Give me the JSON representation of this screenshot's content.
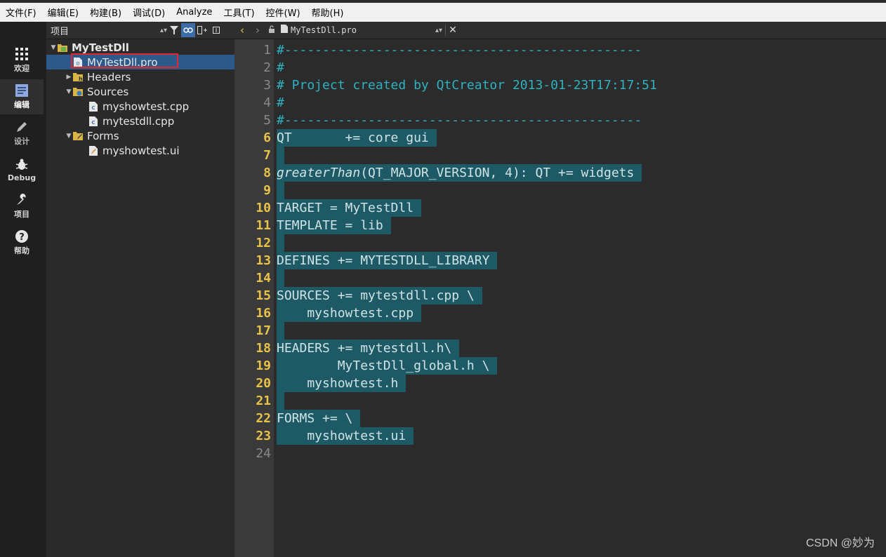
{
  "menubar": {
    "items": [
      "文件(F)",
      "编辑(E)",
      "构建(B)",
      "调试(D)",
      "Analyze",
      "工具(T)",
      "控件(W)",
      "帮助(H)"
    ]
  },
  "modes": [
    {
      "label": "欢迎",
      "icon": "grid-icon"
    },
    {
      "label": "编辑",
      "icon": "document-icon"
    },
    {
      "label": "设计",
      "icon": "pencil-icon"
    },
    {
      "label": "Debug",
      "icon": "bug-icon"
    },
    {
      "label": "项目",
      "icon": "wrench-icon"
    },
    {
      "label": "帮助",
      "icon": "help-icon"
    }
  ],
  "project_panel": {
    "selector_label": "项目",
    "tree": [
      {
        "label": "MyTestDll",
        "level": 0,
        "expanded": true,
        "icon": "project-icon"
      },
      {
        "label": "MyTestDll.pro",
        "level": 1,
        "selected": true,
        "icon": "pro-file-icon"
      },
      {
        "label": "Headers",
        "level": 1,
        "expanded": false,
        "icon": "headers-folder-icon"
      },
      {
        "label": "Sources",
        "level": 1,
        "expanded": true,
        "icon": "sources-folder-icon"
      },
      {
        "label": "myshowtest.cpp",
        "level": 2,
        "icon": "cpp-file-icon"
      },
      {
        "label": "mytestdll.cpp",
        "level": 2,
        "icon": "cpp-file-icon"
      },
      {
        "label": "Forms",
        "level": 1,
        "expanded": true,
        "icon": "forms-folder-icon"
      },
      {
        "label": "myshowtest.ui",
        "level": 2,
        "icon": "ui-file-icon"
      }
    ]
  },
  "editor": {
    "document_name": "MyTestDll.pro",
    "lines": [
      {
        "n": "1",
        "text": "#-----------------------------------------------",
        "kind": "comment"
      },
      {
        "n": "2",
        "text": "#",
        "kind": "comment"
      },
      {
        "n": "3",
        "text": "# Project created by QtCreator 2013-01-23T17:17:51",
        "kind": "comment"
      },
      {
        "n": "4",
        "text": "#",
        "kind": "comment"
      },
      {
        "n": "5",
        "text": "#-----------------------------------------------",
        "kind": "comment"
      },
      {
        "n": "6",
        "text": "QT       += core gui ",
        "kind": "sel"
      },
      {
        "n": "7",
        "text": " ",
        "kind": "sel"
      },
      {
        "n": "8",
        "text": "(QT_MAJOR_VERSION, 4): QT += widgets ",
        "kind": "sel",
        "italic_prefix": "greaterThan"
      },
      {
        "n": "9",
        "text": " ",
        "kind": "sel"
      },
      {
        "n": "10",
        "text": "TARGET = MyTestDll ",
        "kind": "sel"
      },
      {
        "n": "11",
        "text": "TEMPLATE = lib ",
        "kind": "sel"
      },
      {
        "n": "12",
        "text": " ",
        "kind": "sel"
      },
      {
        "n": "13",
        "text": "DEFINES += MYTESTDLL_LIBRARY ",
        "kind": "sel"
      },
      {
        "n": "14",
        "text": " ",
        "kind": "sel"
      },
      {
        "n": "15",
        "text": "SOURCES += mytestdll.cpp \\ ",
        "kind": "sel"
      },
      {
        "n": "16",
        "text": "    myshowtest.cpp ",
        "kind": "sel"
      },
      {
        "n": "17",
        "text": " ",
        "kind": "sel"
      },
      {
        "n": "18",
        "text": "HEADERS += mytestdll.h\\ ",
        "kind": "sel"
      },
      {
        "n": "19",
        "text": "        MyTestDll_global.h \\ ",
        "kind": "sel"
      },
      {
        "n": "20",
        "text": "    myshowtest.h ",
        "kind": "sel"
      },
      {
        "n": "21",
        "text": " ",
        "kind": "sel"
      },
      {
        "n": "22",
        "text": "FORMS += \\ ",
        "kind": "sel"
      },
      {
        "n": "23",
        "text": "    myshowtest.ui ",
        "kind": "sel"
      },
      {
        "n": "24",
        "text": "",
        "kind": "plain"
      }
    ]
  },
  "watermark": "CSDN @妙为",
  "colors": {
    "selection": "#1e5a66",
    "comment": "#2fb2c0",
    "line_number_highlight": "#e8c34a",
    "tree_selection": "#2d5a8a",
    "highlight_box": "#e0282e"
  }
}
